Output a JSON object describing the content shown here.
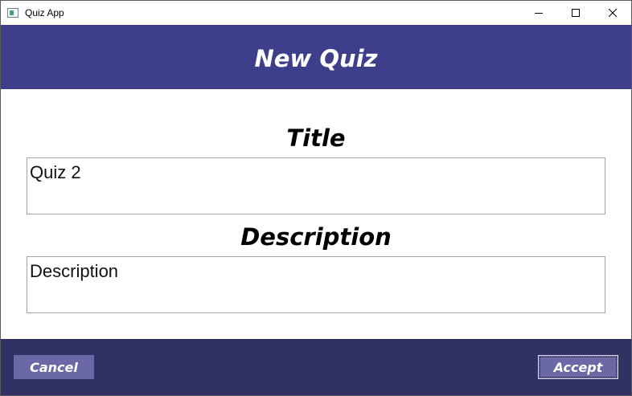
{
  "window": {
    "title": "Quiz App",
    "controls": {
      "minimize_icon": "minimize-icon",
      "maximize_icon": "maximize-icon",
      "close_icon": "close-icon"
    }
  },
  "header": {
    "title": "New Quiz",
    "background": "#3d3f8a"
  },
  "form": {
    "title_label": "Title",
    "title_value": "Quiz 2",
    "description_label": "Description",
    "description_value": "Description"
  },
  "footer": {
    "background": "#2f3263",
    "cancel_label": "Cancel",
    "accept_label": "Accept",
    "button_color": "#6b68a6"
  }
}
